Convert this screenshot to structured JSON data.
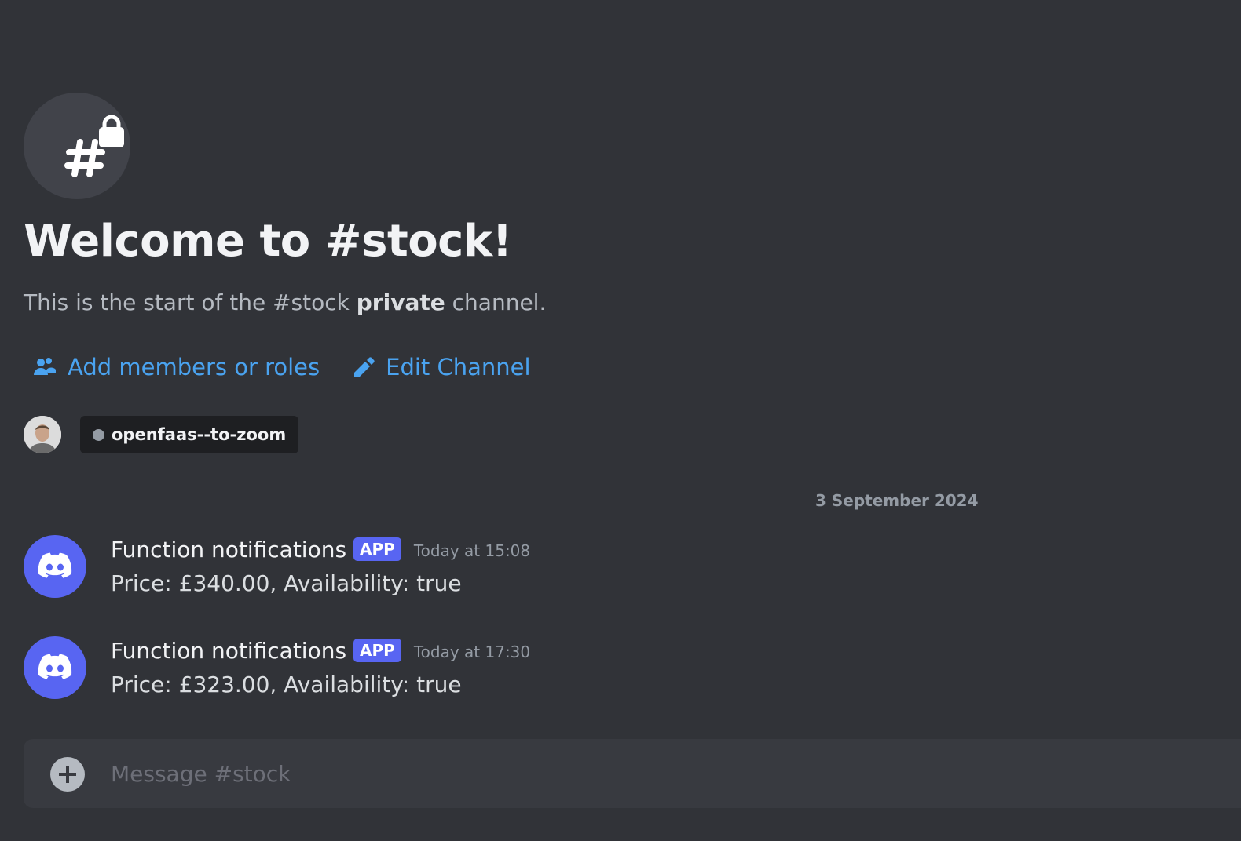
{
  "channel": {
    "name": "#stock",
    "icon": "private-channel-hash-lock-icon"
  },
  "welcome": {
    "title": "Welcome to #stock!",
    "sub_prefix": "This is the start of the #stock ",
    "sub_bold": "private",
    "sub_suffix": " channel."
  },
  "actions": {
    "add_members_label": "Add members or roles",
    "edit_channel_label": "Edit Channel"
  },
  "member": {
    "name": "openfaas--to-zoom",
    "status_color": "#949ba4"
  },
  "date_divider": "3 September 2024",
  "messages": [
    {
      "author": "Function notifications",
      "badge": "APP",
      "time": "Today at 15:08",
      "text": "Price: £340.00, Availability: true"
    },
    {
      "author": "Function notifications",
      "badge": "APP",
      "time": "Today at 17:30",
      "text": "Price: £323.00, Availability: true"
    }
  ],
  "composer": {
    "placeholder": "Message #stock"
  },
  "colors": {
    "background": "#313338",
    "link": "#4aa3f0",
    "brand": "#5865f2"
  }
}
